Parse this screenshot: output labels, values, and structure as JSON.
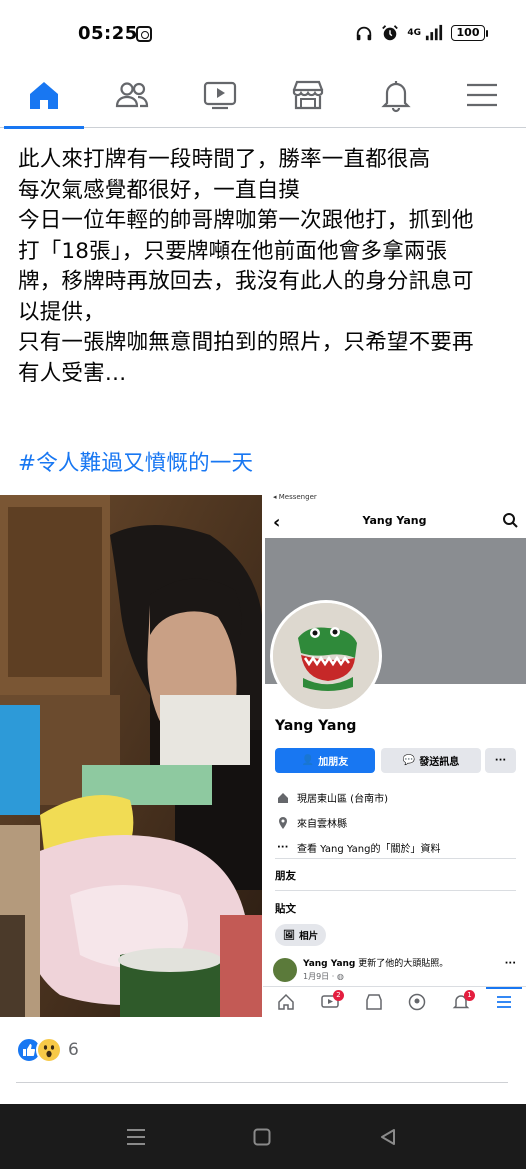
{
  "status_bar": {
    "time": "05:25",
    "network": "4G",
    "battery": "100"
  },
  "nav": {
    "tabs": [
      {
        "name": "home-icon",
        "active": true
      },
      {
        "name": "friends-icon",
        "active": false
      },
      {
        "name": "watch-icon",
        "active": false
      },
      {
        "name": "marketplace-icon",
        "active": false
      },
      {
        "name": "notifications-icon",
        "active": false
      },
      {
        "name": "menu-icon",
        "active": false
      }
    ],
    "accent_color": "#1877f2"
  },
  "post": {
    "lines": [
      "此人來打牌有一段時間了，勝率一直都很高",
      "每次氣感覺都很好，一直自摸",
      "今日一位年輕的帥哥牌咖第一次跟他打，抓到他",
      "打「18張」，只要牌噸在他前面他會多拿兩張",
      "牌，移牌時再放回去，我沒有此人的身分訊息可",
      "以提供，",
      "只有一張牌咖無意間拍到的照片，只希望不要再",
      "有人受害…"
    ],
    "hashtag": "#令人難過又憤慨的一天"
  },
  "screenshot": {
    "messenger_back": "◂ Messenger",
    "header_title": "Yang Yang",
    "profile_name": "Yang Yang",
    "add_friend_label": "加朋友",
    "message_label": "發送訊息",
    "more_label": "···",
    "lives_in": "現居東山區 (台南市)",
    "from": "來自雲林縣",
    "about": "查看 Yang Yang的「關於」資料",
    "friends_section": "朋友",
    "posts_section": "貼文",
    "photos_chip": "相片",
    "update_name": "Yang Yang",
    "update_text": " 更新了他的大頭貼照。",
    "update_date": "1月9日 · ",
    "watch_badge": "2",
    "notif_badge": "1"
  },
  "reactions": {
    "count": "6",
    "types": [
      "like",
      "wow"
    ]
  }
}
